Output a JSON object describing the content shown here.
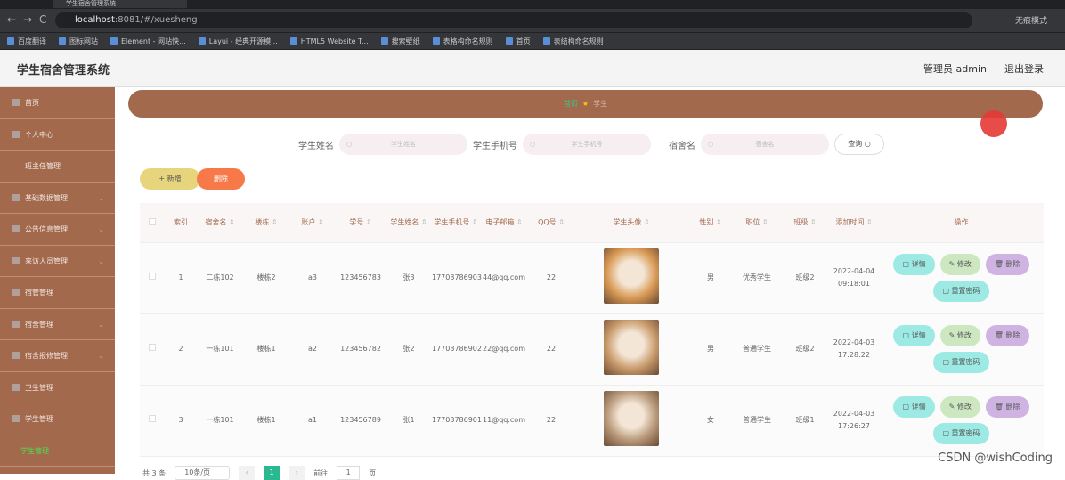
{
  "browser": {
    "tab_title": "学生宿舍管理系统",
    "url_host": "localhost",
    "url_path": ":8081/#/xuesheng",
    "profile": "无痕模式",
    "bookmarks": [
      "百度翻译",
      "图标网站",
      "Element - 网站快...",
      "Layui - 经典开源模...",
      "HTML5 Website T...",
      "搜索壁纸",
      "表格构命名规则",
      "首页",
      "表结构命名规则"
    ]
  },
  "header": {
    "title": "学生宿舍管理系统",
    "user": "管理员 admin",
    "logout": "退出登录"
  },
  "sidebar": {
    "items": [
      {
        "label": "首页",
        "icon": "home-icon"
      },
      {
        "label": "个人中心",
        "icon": "user-icon"
      },
      {
        "label": "班主任管理",
        "sub": true
      },
      {
        "label": "基础数据管理",
        "icon": "grid-icon",
        "chev": true
      },
      {
        "label": "公告信息管理",
        "icon": "list-icon",
        "chev": true
      },
      {
        "label": "来访人员管理",
        "icon": "chart-icon",
        "chev": true
      },
      {
        "label": "宿管管理",
        "icon": "doc-icon"
      },
      {
        "label": "宿舍管理",
        "icon": "building-icon",
        "chev": true
      },
      {
        "label": "宿舍报修管理",
        "icon": "tool-icon",
        "chev": true
      },
      {
        "label": "卫生管理",
        "icon": "broom-icon"
      },
      {
        "label": "学生管理",
        "icon": "student-icon"
      },
      {
        "label": "学生管理",
        "active": true
      }
    ]
  },
  "breadcrumb": {
    "home": "首页",
    "current": "学生"
  },
  "search": {
    "name_label": "学生姓名",
    "name_placeholder": "学生姓名",
    "phone_label": "学生手机号",
    "phone_placeholder": "学生手机号",
    "dorm_label": "宿舍名",
    "dorm_placeholder": "宿舍名",
    "query": "查询"
  },
  "actions": {
    "add": "+ 新增",
    "delete": "删除"
  },
  "table": {
    "headers": [
      "索引",
      "宿舍名",
      "楼栋",
      "账户",
      "学号",
      "学生姓名",
      "学生手机号",
      "电子邮箱",
      "QQ号",
      "学生头像",
      "性别",
      "职位",
      "班级",
      "添加时间",
      "操作"
    ],
    "rows": [
      {
        "idx": "1",
        "dorm": "二栋102",
        "building": "楼栋2",
        "account": "a3",
        "sno": "123456783",
        "name": "张3",
        "phone": "17703786903",
        "email": "44@qq.com",
        "qq": "22",
        "photo_color": "#d99a55",
        "gender": "男",
        "position": "优秀学生",
        "class": "班级2",
        "time": "2022-04-04 09:18:01"
      },
      {
        "idx": "2",
        "dorm": "一栋101",
        "building": "楼栋1",
        "account": "a2",
        "sno": "123456782",
        "name": "张2",
        "phone": "17703786902",
        "email": "22@qq.com",
        "qq": "22",
        "photo_color": "#c89a6b",
        "gender": "男",
        "position": "普通学生",
        "class": "班级2",
        "time": "2022-04-03 17:28:22"
      },
      {
        "idx": "3",
        "dorm": "一栋101",
        "building": "楼栋1",
        "account": "a1",
        "sno": "123456789",
        "name": "张1",
        "phone": "17703786901",
        "email": "11@qq.com",
        "qq": "22",
        "photo_color": "#b8997a",
        "gender": "女",
        "position": "普通学生",
        "class": "班级1",
        "time": "2022-04-03 17:26:27"
      }
    ],
    "ops": {
      "detail": "详情",
      "edit": "修改",
      "delete": "删除",
      "reset": "重置密码"
    }
  },
  "pager": {
    "total": "共 3 条",
    "size": "10条/页",
    "page": "1",
    "goto": "前往",
    "jump": "1",
    "unit": "页"
  },
  "watermark": "CSDN @wishCoding"
}
